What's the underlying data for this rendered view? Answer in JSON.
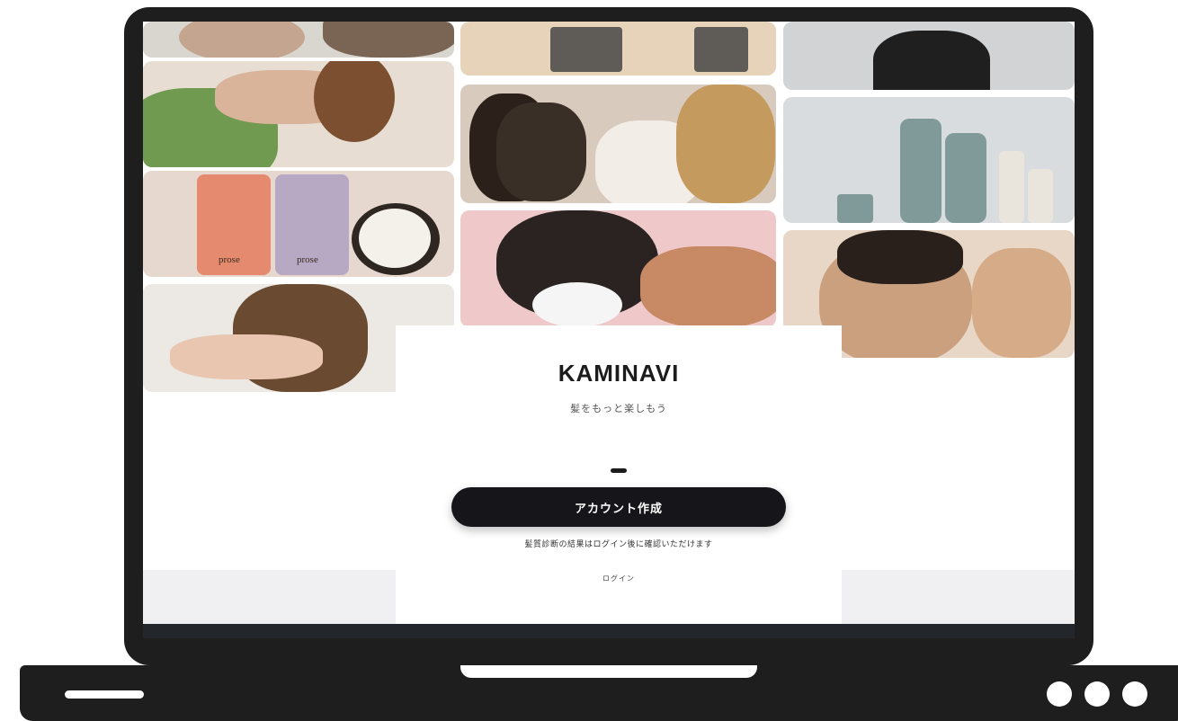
{
  "app": {
    "brand": "KAMINAVI",
    "tagline": "髪をもっと楽しもう",
    "cta_label": "アカウント作成",
    "note": "髪質診断の結果はログイン後に確認いただけます",
    "login_label": "ログイン"
  },
  "product_text": {
    "bottle_brand_1": "prose",
    "bottle_brand_2": "prose"
  },
  "colors": {
    "frame": "#1e1e1e",
    "cta_background": "#16161a",
    "cta_text": "#ffffff",
    "panel_gray": "#f0f0f3"
  },
  "icons": {
    "footer_dots": "three-dots-icon"
  }
}
